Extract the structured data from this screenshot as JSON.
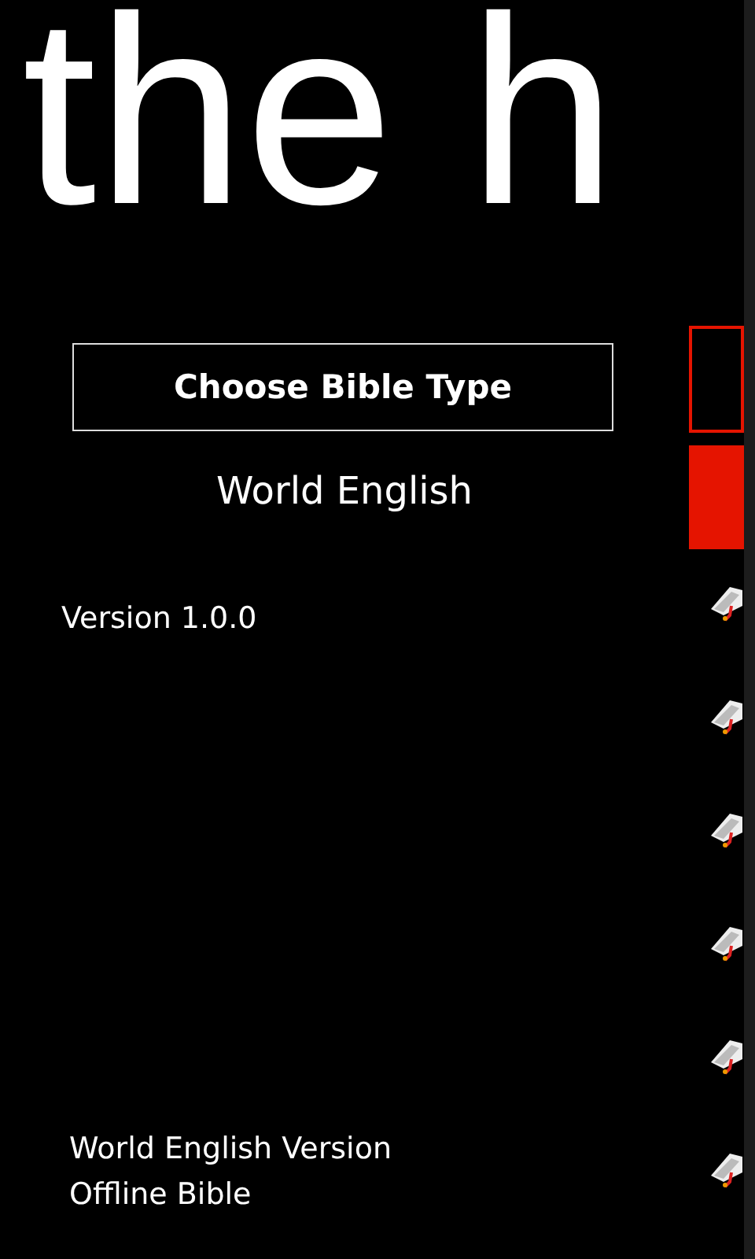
{
  "title": "the h",
  "left": {
    "choose_button": "Choose Bible Type",
    "bible_type": "World English",
    "version": "Version 1.0.0",
    "footer": [
      "World English Version",
      "Offline Bible"
    ]
  },
  "right": {
    "buttons": [
      {
        "kind": "outline"
      },
      {
        "kind": "filled"
      }
    ],
    "books": [
      {
        "kind": "book"
      },
      {
        "kind": "book"
      },
      {
        "kind": "book"
      },
      {
        "kind": "book"
      },
      {
        "kind": "book"
      },
      {
        "kind": "book"
      }
    ]
  }
}
